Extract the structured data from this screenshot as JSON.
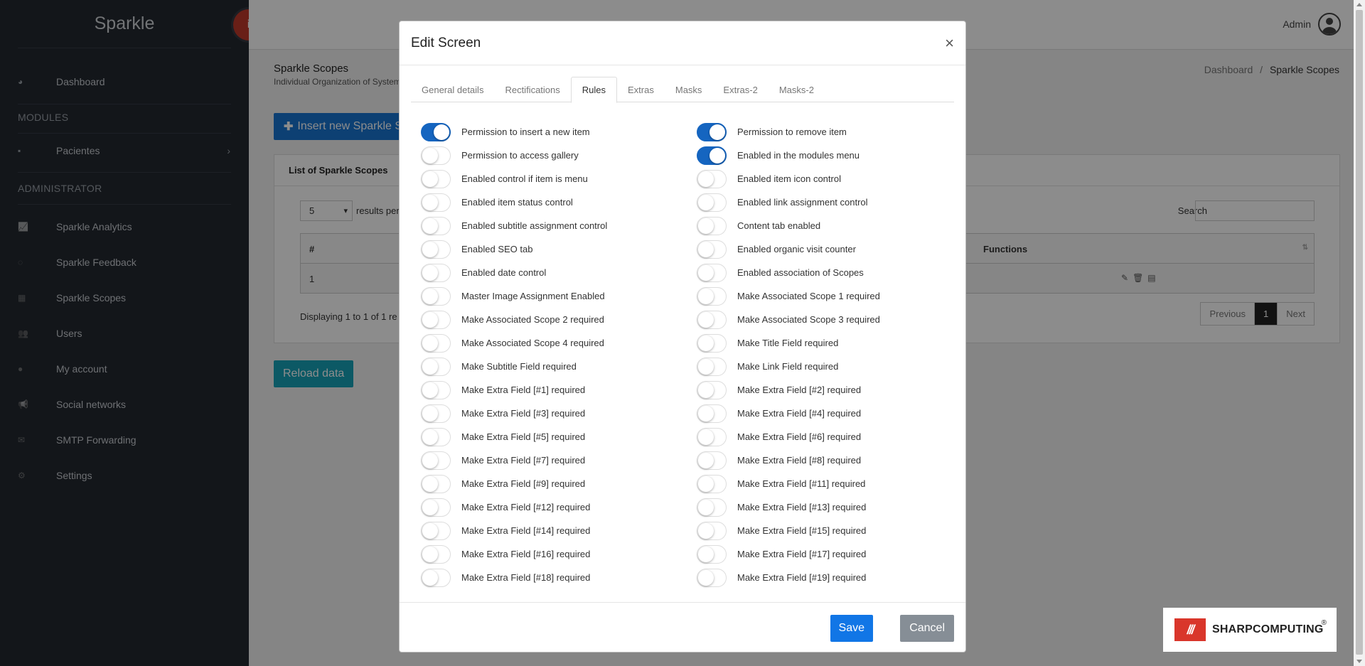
{
  "app": {
    "brand": "Sparkle"
  },
  "sidebar": {
    "dashboard": "Dashboard",
    "modules_title": "MODULES",
    "pacientes": "Pacientes",
    "admin_title": "ADMINISTRATOR",
    "items": [
      {
        "label": "Sparkle Analytics",
        "icon": "chart-icon"
      },
      {
        "label": "Sparkle Feedback",
        "icon": "feedback-icon"
      },
      {
        "label": "Sparkle Scopes",
        "icon": "grid-icon"
      },
      {
        "label": "Users",
        "icon": "users-icon"
      },
      {
        "label": "My account",
        "icon": "user-icon"
      },
      {
        "label": "Social networks",
        "icon": "bullhorn-icon"
      },
      {
        "label": "SMTP Forwarding",
        "icon": "envelope-icon"
      },
      {
        "label": "Settings",
        "icon": "gear-icon"
      }
    ]
  },
  "topbar": {
    "user": "Admin"
  },
  "page": {
    "title": "Sparkle Scopes",
    "subtitle": "Individual Organization of System",
    "breadcrumb_home": "Dashboard",
    "breadcrumb_sep": "/",
    "breadcrumb_current": "Sparkle Scopes",
    "insert_button": "Insert new Sparkle Sc",
    "list_title": "List of Sparkle Scopes",
    "page_size": "5",
    "page_size_label": "results per",
    "search_label": "Search",
    "col_hash": "#",
    "col_functions": "Functions",
    "row_id": "1",
    "displaying": "Displaying 1 to 1 of 1 re",
    "pager_prev": "Previous",
    "pager_current": "1",
    "pager_next": "Next",
    "reload_button": "Reload data"
  },
  "modal": {
    "title": "Edit Screen",
    "close": "×",
    "tabs": [
      "General details",
      "Rectifications",
      "Rules",
      "Extras",
      "Masks",
      "Extras-2",
      "Masks-2"
    ],
    "active_tab": "Rules",
    "rules_left": [
      {
        "label": "Permission to insert a new item",
        "on": true
      },
      {
        "label": "Permission to access gallery",
        "on": false
      },
      {
        "label": "Enabled control if item is menu",
        "on": false
      },
      {
        "label": "Enabled item status control",
        "on": false
      },
      {
        "label": "Enabled subtitle assignment control",
        "on": false
      },
      {
        "label": "Enabled SEO tab",
        "on": false
      },
      {
        "label": "Enabled date control",
        "on": false
      },
      {
        "label": "Master Image Assignment Enabled",
        "on": false
      },
      {
        "label": "Make Associated Scope 2 required",
        "on": false
      },
      {
        "label": "Make Associated Scope 4 required",
        "on": false
      },
      {
        "label": "Make Subtitle Field required",
        "on": false
      },
      {
        "label": "Make Extra Field [#1] required",
        "on": false
      },
      {
        "label": "Make Extra Field [#3] required",
        "on": false
      },
      {
        "label": "Make Extra Field [#5] required",
        "on": false
      },
      {
        "label": "Make Extra Field [#7] required",
        "on": false
      },
      {
        "label": "Make Extra Field [#9] required",
        "on": false
      },
      {
        "label": "Make Extra Field [#12] required",
        "on": false
      },
      {
        "label": "Make Extra Field [#14] required",
        "on": false
      },
      {
        "label": "Make Extra Field [#16] required",
        "on": false
      },
      {
        "label": "Make Extra Field [#18] required",
        "on": false
      }
    ],
    "rules_right": [
      {
        "label": "Permission to remove item",
        "on": true
      },
      {
        "label": "Enabled in the modules menu",
        "on": true
      },
      {
        "label": "Enabled item icon control",
        "on": false
      },
      {
        "label": "Enabled link assignment control",
        "on": false
      },
      {
        "label": "Content tab enabled",
        "on": false
      },
      {
        "label": "Enabled organic visit counter",
        "on": false
      },
      {
        "label": "Enabled association of Scopes",
        "on": false
      },
      {
        "label": "Make Associated Scope 1 required",
        "on": false
      },
      {
        "label": "Make Associated Scope 3 required",
        "on": false
      },
      {
        "label": "Make Title Field required",
        "on": false
      },
      {
        "label": "Make Link Field required",
        "on": false
      },
      {
        "label": "Make Extra Field [#2] required",
        "on": false
      },
      {
        "label": "Make Extra Field [#4] required",
        "on": false
      },
      {
        "label": "Make Extra Field [#6] required",
        "on": false
      },
      {
        "label": "Make Extra Field [#8] required",
        "on": false
      },
      {
        "label": "Make Extra Field [#11] required",
        "on": false
      },
      {
        "label": "Make Extra Field [#13] required",
        "on": false
      },
      {
        "label": "Make Extra Field [#15] required",
        "on": false
      },
      {
        "label": "Make Extra Field [#17] required",
        "on": false
      },
      {
        "label": "Make Extra Field [#19] required",
        "on": false
      }
    ],
    "save": "Save",
    "cancel": "Cancel"
  },
  "logo": {
    "mark": "///",
    "text": "SHARPCOMPUTING",
    "reg": "®"
  },
  "colors": {
    "accent": "#1565c0",
    "sidebar": "#232830",
    "danger": "#c0392b",
    "teal": "#17a2b8"
  }
}
